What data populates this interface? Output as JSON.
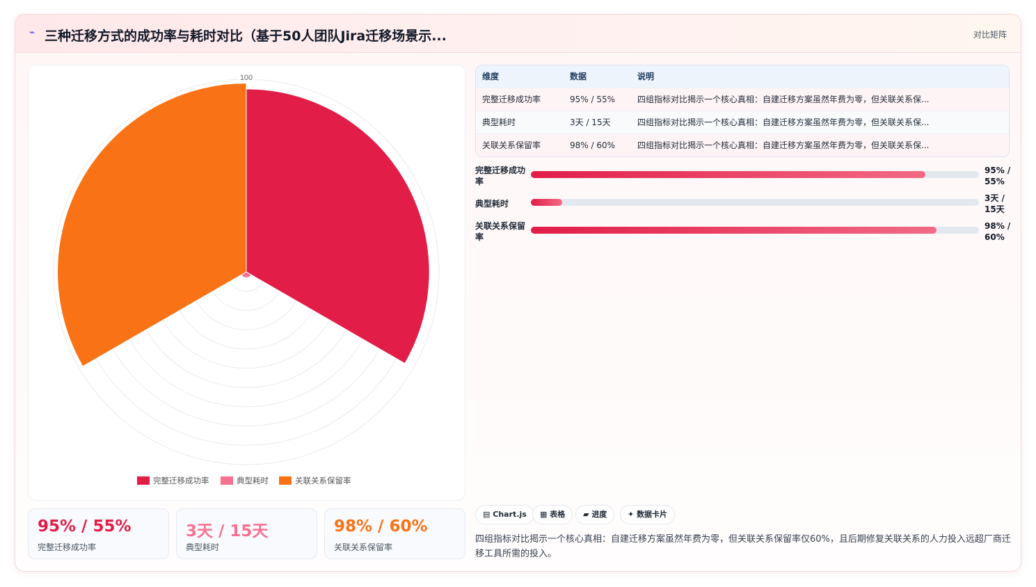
{
  "header": {
    "icon": "lightning-icon",
    "title": "三种迁移方式的成功率与耗时对比（基于50人团队Jira迁移场景示...",
    "tag": "对比矩阵"
  },
  "chart_data": {
    "type": "polarArea",
    "categories": [
      "完整迁移成功率",
      "典型耗时",
      "关联关系保留率"
    ],
    "values": [
      95,
      3,
      98
    ],
    "colors": [
      "#e11d48",
      "#f87190",
      "#f97316"
    ],
    "rmax": 100,
    "tick_labels": [
      "100"
    ],
    "legend": [
      "完整迁移成功率",
      "典型耗时",
      "关联关系保留率"
    ],
    "legend_position": "bottom"
  },
  "kpis": [
    {
      "value": "95% / 55%",
      "label": "完整迁移成功率",
      "color": "#e11d48"
    },
    {
      "value": "3天 / 15天",
      "label": "典型耗时",
      "color": "#f87190"
    },
    {
      "value": "98% / 60%",
      "label": "关联关系保留率",
      "color": "#f97316"
    }
  ],
  "table": {
    "headers": [
      "维度",
      "数据",
      "说明"
    ],
    "rows": [
      [
        "完整迁移成功率",
        "95% / 55%",
        "四组指标对比揭示一个核心真相：自建迁移方案虽然年费为零，但关联关系保..."
      ],
      [
        "典型耗时",
        "3天 / 15天",
        "四组指标对比揭示一个核心真相：自建迁移方案虽然年费为零，但关联关系保..."
      ],
      [
        "关联关系保留率",
        "98% / 60%",
        "四组指标对比揭示一个核心真相：自建迁移方案虽然年费为零，但关联关系保..."
      ]
    ]
  },
  "progress": [
    {
      "label": "完整迁移成功率",
      "value": "95% / 55%",
      "fill": 0.88
    },
    {
      "label": "典型耗时",
      "value": "3天 / 15天",
      "fill": 0.07
    },
    {
      "label": "关联关系保留率",
      "value": "98% / 60%",
      "fill": 0.905
    }
  ],
  "chips": [
    {
      "icon": "chart-icon",
      "glyph": "▤",
      "label": "Chart.js"
    },
    {
      "icon": "table-icon",
      "glyph": "▦",
      "label": "表格"
    },
    {
      "icon": "progress-icon",
      "glyph": "▰",
      "label": "进度"
    },
    {
      "icon": "sparkle-icon",
      "glyph": "✦",
      "label": "数据卡片"
    }
  ],
  "note": "四组指标对比揭示一个核心真相：自建迁移方案虽然年费为零，但关联关系保留率仅60%，且后期修复关联关系的人力投入远超厂商迁移工具所需的投入。"
}
